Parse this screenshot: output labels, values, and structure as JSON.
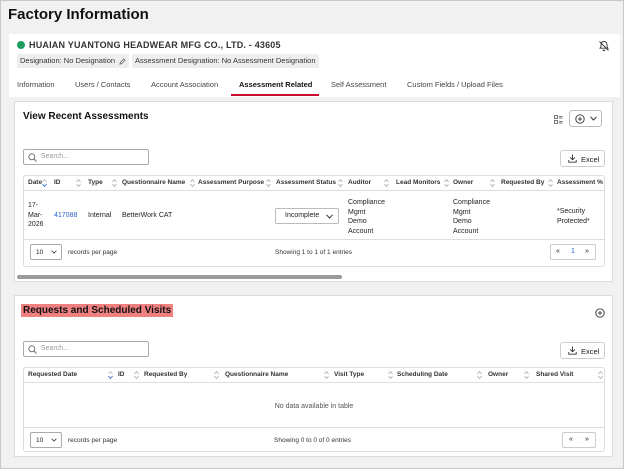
{
  "page": {
    "title": "Factory Information"
  },
  "company": {
    "name": "HUAIAN YUANTONG HEADWEAR MFG CO., LTD. - 43605",
    "status_color": "#1f9e64",
    "designation": "Designation: No Designation",
    "assessment_designation": "Assessment Designation: No Assessment Designation"
  },
  "tabs": [
    "Information",
    "Users / Contacts",
    "Account Association",
    "Assessment Related",
    "Self Assessment",
    "Custom Fields / Upload Files"
  ],
  "active_tab": "Assessment Related",
  "accent_color": "#c8102e",
  "recent": {
    "title": "View Recent Assessments",
    "search_placeholder": "Search...",
    "excel_label": "Excel",
    "columns": [
      "Date",
      "ID",
      "Type",
      "Questionnaire Name",
      "Assessment Purpose",
      "Assessment Status",
      "Auditor",
      "Lead Monitors",
      "Owner",
      "Requested By",
      "Assessment % Sc"
    ],
    "rows": [
      {
        "date": [
          "17-",
          "Mar-",
          "2026"
        ],
        "id": "417088",
        "type": "Internal",
        "questionnaire": "BetterWork CAT",
        "purpose": "",
        "status": "Incomplete",
        "auditor": [
          "Compliance",
          "Mgmt",
          "Demo",
          "Account"
        ],
        "lead_monitors": "",
        "owner": [
          "Compliance",
          "Mgmt",
          "Demo",
          "Account"
        ],
        "requested_by": "",
        "score": [
          "*Security",
          "Protected*"
        ]
      }
    ],
    "page_size": "10",
    "records_label": "records per page",
    "info": "Showing 1 to 1 of 1 entries",
    "current_page": "1",
    "prev": "«",
    "next": "»"
  },
  "visits": {
    "title": "Requests and Scheduled Visits",
    "highlight_color": "#ef8080",
    "search_placeholder": "Search...",
    "excel_label": "Excel",
    "columns": [
      "Requested Date",
      "ID",
      "Requested By",
      "Questionnaire Name",
      "Visit Type",
      "Scheduling Date",
      "Owner",
      "Shared Visit"
    ],
    "empty_text": "No data available in table",
    "page_size": "10",
    "records_label": "records per page",
    "info": "Showing 0 to 0 of 0 entries",
    "prev": "«",
    "next": "»"
  }
}
